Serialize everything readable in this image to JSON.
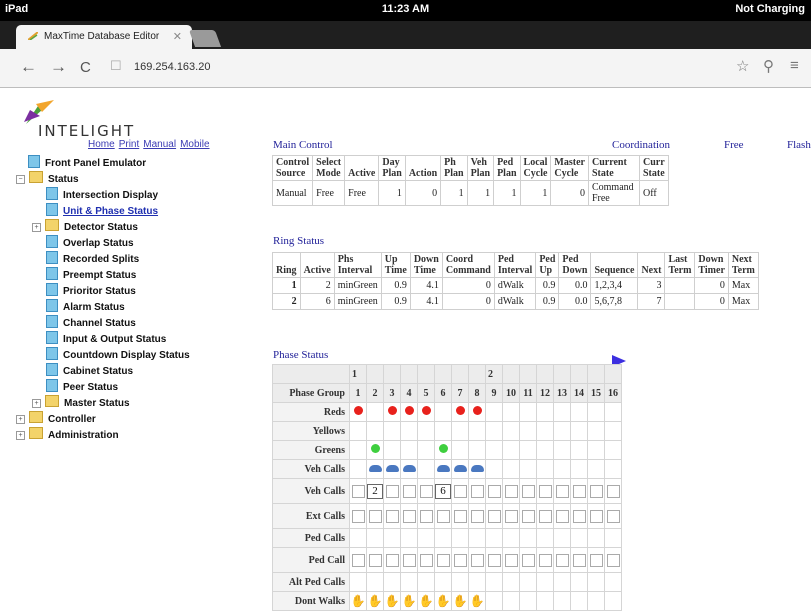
{
  "device": {
    "carrier": "iPad",
    "time": "11:23 AM",
    "battery": "Not Charging"
  },
  "browser": {
    "tab_title": "MaxTime Database Editor",
    "url": "169.254.163.20"
  },
  "brand": {
    "name": "INTELIGHT"
  },
  "top_links": [
    "Home",
    "Print",
    "Manual",
    "Mobile"
  ],
  "tree": {
    "front_panel": "Front Panel Emulator",
    "status": "Status",
    "items": [
      "Intersection Display",
      "Unit & Phase Status",
      "Detector Status",
      "Overlap Status",
      "Recorded Splits",
      "Preempt Status",
      "Prioritor Status",
      "Alarm Status",
      "Channel Status",
      "Input & Output Status",
      "Countdown Display Status",
      "Cabinet Status",
      "Peer Status",
      "Master Status"
    ],
    "controller": "Controller",
    "administration": "Administration"
  },
  "main_control": {
    "title": "Main Control",
    "coord_title": "Coordination",
    "free_title": "Free",
    "flash_title": "Flash",
    "headers": [
      [
        "Control",
        "Source"
      ],
      [
        "Select",
        "Mode"
      ],
      [
        "",
        "Active"
      ],
      [
        "Day",
        "Plan"
      ],
      [
        "",
        "Action"
      ],
      [
        "Ph",
        "Plan"
      ],
      [
        "Veh",
        "Plan"
      ],
      [
        "Ped",
        "Plan"
      ],
      [
        "Local",
        "Cycle"
      ],
      [
        "Master",
        "Cycle"
      ],
      [
        "Current",
        "State"
      ],
      [
        "Curr",
        "State"
      ]
    ],
    "values": [
      "Manual",
      "Free",
      "Free",
      "1",
      "0",
      "1",
      "1",
      "1",
      "1",
      "0",
      "Command Free",
      "Off"
    ]
  },
  "ring_status": {
    "title": "Ring Status",
    "headers": [
      [
        "",
        "Ring"
      ],
      [
        "",
        "Active"
      ],
      [
        "Phs",
        "Interval"
      ],
      [
        "Up",
        "Time"
      ],
      [
        "Down",
        "Time"
      ],
      [
        "Coord",
        "Command"
      ],
      [
        "Ped",
        "Interval"
      ],
      [
        "Ped",
        "Up"
      ],
      [
        "Ped",
        "Down"
      ],
      [
        "",
        "Sequence"
      ],
      [
        "",
        "Next"
      ],
      [
        "Last",
        "Term"
      ],
      [
        "Down",
        "Timer"
      ],
      [
        "Next",
        "Term"
      ]
    ],
    "rows": [
      [
        "1",
        "2",
        "minGreen",
        "0.9",
        "4.1",
        "0",
        "dWalk",
        "0.9",
        "0.0",
        "1,2,3,4",
        "3",
        "",
        "0",
        "Max"
      ],
      [
        "2",
        "6",
        "minGreen",
        "0.9",
        "4.1",
        "0",
        "dWalk",
        "0.9",
        "0.0",
        "5,6,7,8",
        "7",
        "",
        "0",
        "Max"
      ]
    ]
  },
  "phase_status": {
    "title": "Phase Status",
    "group_label": "Phase Group",
    "groups": [
      "1",
      "2"
    ],
    "phases": [
      "1",
      "2",
      "3",
      "4",
      "5",
      "6",
      "7",
      "8",
      "9",
      "10",
      "11",
      "12",
      "13",
      "14",
      "15",
      "16"
    ],
    "row_labels": {
      "reds": "Reds",
      "yellows": "Yellows",
      "greens": "Greens",
      "veh_calls_icons": "Veh Calls",
      "veh_calls": "Veh Calls",
      "ext_calls": "Ext Calls",
      "ped_calls": "Ped Calls",
      "ped_call": "Ped Call",
      "alt_ped_calls": "Alt Ped Calls",
      "dont_walks": "Dont Walks"
    },
    "reds": [
      1,
      0,
      1,
      1,
      1,
      0,
      1,
      1
    ],
    "greens": [
      0,
      1,
      0,
      0,
      0,
      1,
      0,
      0
    ],
    "veh_call_icons": [
      0,
      1,
      1,
      1,
      0,
      1,
      1,
      1
    ],
    "veh_call_values": {
      "2": "2",
      "6": "6"
    },
    "dont_walks": [
      1,
      1,
      1,
      1,
      1,
      1,
      1,
      1
    ]
  },
  "colors": {
    "link": "#3b3bb3",
    "title": "#23239a",
    "red": "#e8211c",
    "green": "#3fcf3f",
    "hand": "#f29b16"
  }
}
